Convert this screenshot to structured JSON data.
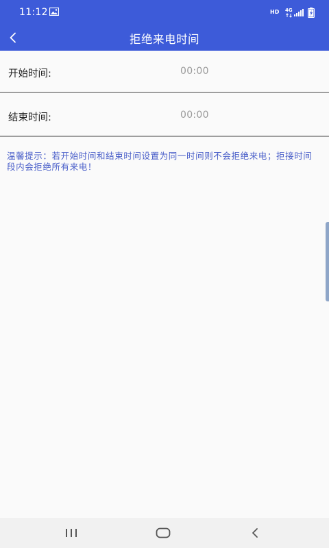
{
  "status_bar": {
    "time": "11:12",
    "hd_label": "HD",
    "network_label": "4G",
    "icons": [
      "gallery-icon",
      "signal-icon",
      "battery-charging-icon"
    ]
  },
  "app_bar": {
    "title": "拒绝来电时间",
    "back_icon": "chevron-left-icon",
    "background_color": "#3d5bd9"
  },
  "rows": [
    {
      "label": "开始时间:",
      "value": "00:00"
    },
    {
      "label": "结束时间:",
      "value": "00:00"
    }
  ],
  "tip": "温馨提示：若开始时间和结束时间设置为同一时间则不会拒绝来电；拒接时间段内会拒绝所有来电！",
  "tip_color": "#4a5fc9",
  "nav_bar": {
    "icons": [
      "recent-apps-icon",
      "home-icon",
      "back-icon"
    ]
  }
}
